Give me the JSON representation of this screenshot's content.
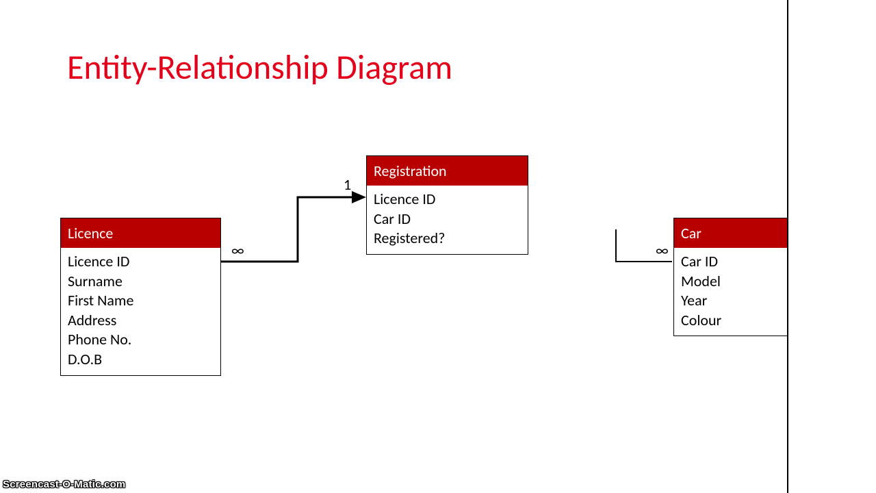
{
  "title": "Entity-Relationship Diagram",
  "entities": {
    "licence": {
      "name": "Licence",
      "fields": [
        "Licence ID",
        "Surname",
        "First Name",
        "Address",
        "Phone No.",
        "D.O.B"
      ]
    },
    "registration": {
      "name": "Registration",
      "fields": [
        "Licence ID",
        "Car ID",
        "Registered?"
      ]
    },
    "car": {
      "name": "Car",
      "fields": [
        "Car ID",
        "Model",
        "Year",
        "Colour"
      ]
    }
  },
  "cardinality": {
    "licence_side": "∞",
    "registration_side": "1",
    "car_side": "∞"
  },
  "watermark": "Screencast-O-Matic.com"
}
